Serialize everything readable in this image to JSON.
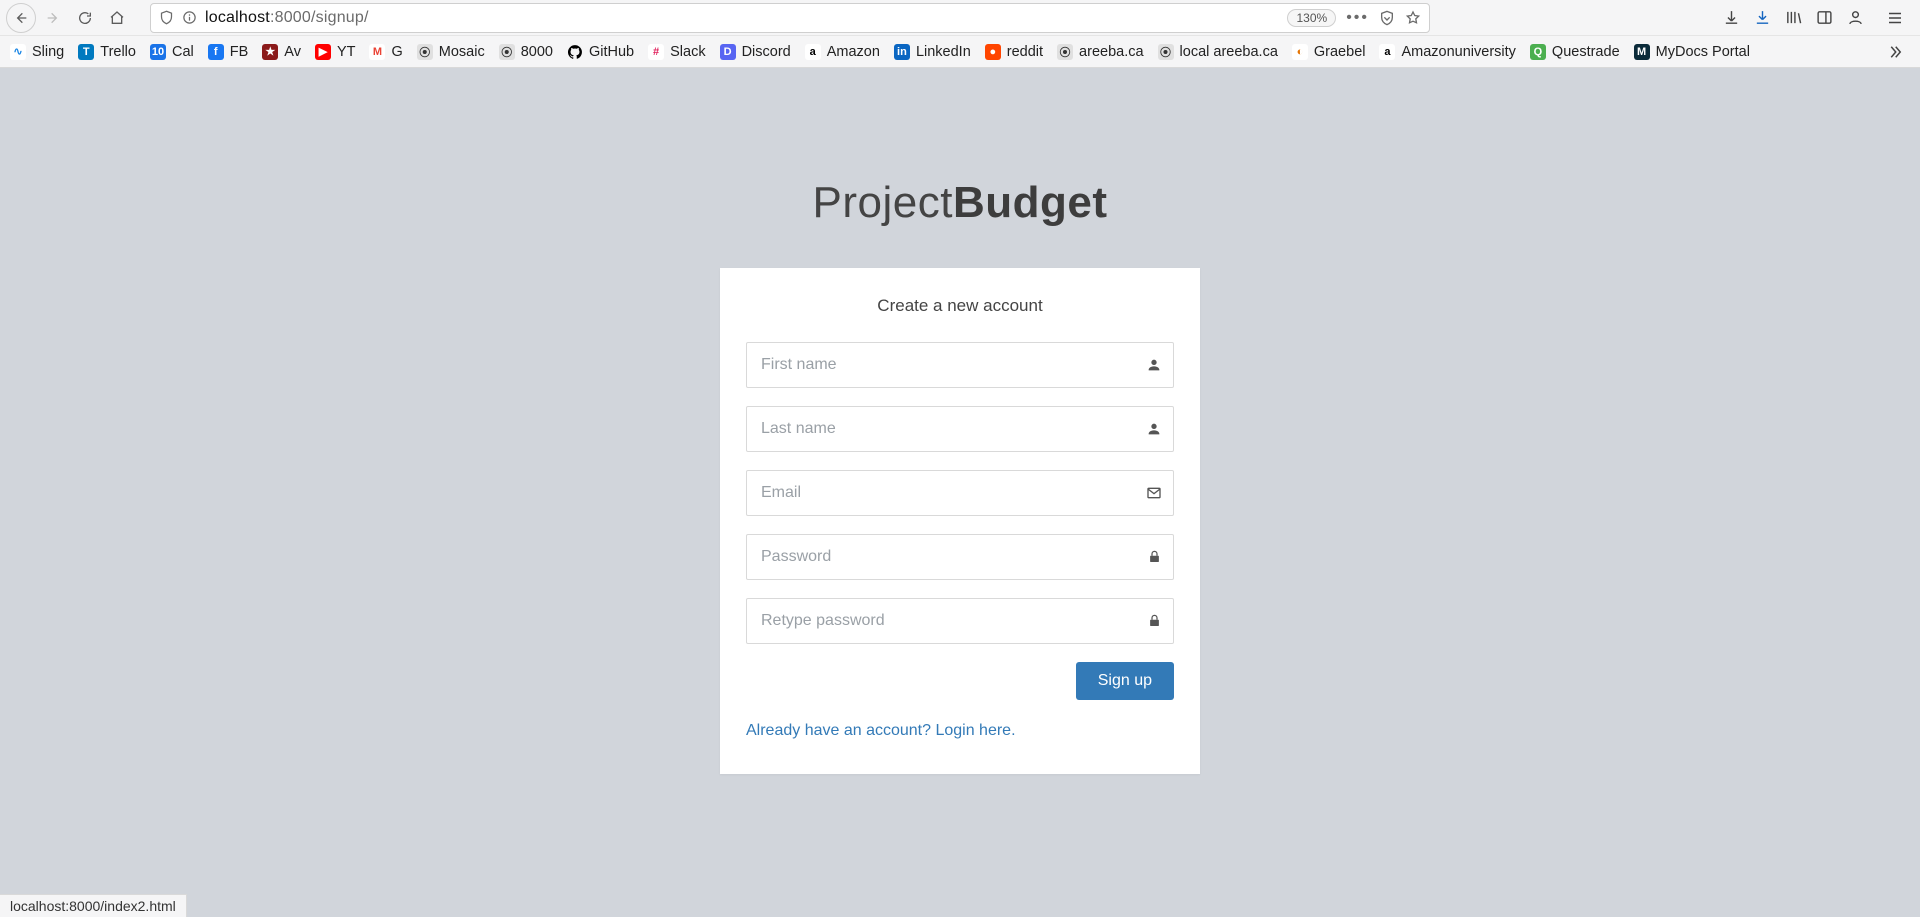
{
  "browser": {
    "url_host": "localhost",
    "url_port_path": ":8000/signup/",
    "zoom": "130%",
    "bookmarks": [
      {
        "label": "Sling",
        "bg": "#fff",
        "fg": "#1e88e5",
        "glyph": "∿"
      },
      {
        "label": "Trello",
        "bg": "#0079bf",
        "fg": "#fff",
        "glyph": "T"
      },
      {
        "label": "Cal",
        "bg": "#1a73e8",
        "fg": "#fff",
        "glyph": "10"
      },
      {
        "label": "FB",
        "bg": "#1877f2",
        "fg": "#fff",
        "glyph": "f"
      },
      {
        "label": "Av",
        "bg": "#8b1a1a",
        "fg": "#fff",
        "glyph": "★"
      },
      {
        "label": "YT",
        "bg": "#ff0000",
        "fg": "#fff",
        "glyph": "▶"
      },
      {
        "label": "G",
        "bg": "#fff",
        "fg": "#ea4335",
        "glyph": "M"
      },
      {
        "label": "Mosaic",
        "bg": "#e0e0e0",
        "fg": "#333",
        "glyph": "⦿"
      },
      {
        "label": "8000",
        "bg": "#e0e0e0",
        "fg": "#333",
        "glyph": "⦿"
      },
      {
        "label": "GitHub",
        "bg": "#fff",
        "fg": "#000",
        "glyph": ""
      },
      {
        "label": "Slack",
        "bg": "#fff",
        "fg": "#e01e5a",
        "glyph": "#"
      },
      {
        "label": "Discord",
        "bg": "#5865f2",
        "fg": "#fff",
        "glyph": "D"
      },
      {
        "label": "Amazon",
        "bg": "#fff",
        "fg": "#000",
        "glyph": "a"
      },
      {
        "label": "LinkedIn",
        "bg": "#0a66c2",
        "fg": "#fff",
        "glyph": "in"
      },
      {
        "label": "reddit",
        "bg": "#ff4500",
        "fg": "#fff",
        "glyph": "●"
      },
      {
        "label": "areeba.ca",
        "bg": "#e0e0e0",
        "fg": "#333",
        "glyph": "⦿"
      },
      {
        "label": "local areeba.ca",
        "bg": "#e0e0e0",
        "fg": "#333",
        "glyph": "⦿"
      },
      {
        "label": "Graebel",
        "bg": "#fff",
        "fg": "#e57300",
        "glyph": "◐"
      },
      {
        "label": "Amazonuniversity",
        "bg": "#fff",
        "fg": "#000",
        "glyph": "a"
      },
      {
        "label": "Questrade",
        "bg": "#4caf50",
        "fg": "#fff",
        "glyph": "Q"
      },
      {
        "label": "MyDocs Portal",
        "bg": "#0b2b3a",
        "fg": "#fff",
        "glyph": "M"
      }
    ],
    "status_text": "localhost:8000/index2.html"
  },
  "brand": {
    "light": "Project",
    "bold": "Budget"
  },
  "form": {
    "title": "Create a new account",
    "first_name_ph": "First name",
    "last_name_ph": "Last name",
    "email_ph": "Email",
    "password_ph": "Password",
    "retype_ph": "Retype password",
    "submit_label": "Sign up"
  },
  "login_link_text": "Already have an account? Login here."
}
